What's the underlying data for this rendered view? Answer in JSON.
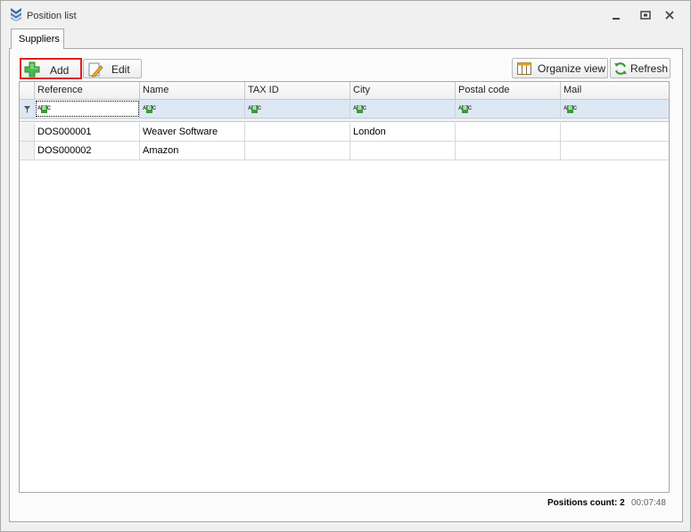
{
  "window": {
    "title": "Position list"
  },
  "tabs": [
    {
      "label": "Suppliers",
      "active": true
    }
  ],
  "toolbar": {
    "add_label": "Add",
    "edit_label": "Edit",
    "organize_label": "Organize view",
    "refresh_label": "Refresh"
  },
  "grid": {
    "columns": [
      "Reference",
      "Name",
      "TAX ID",
      "City",
      "Postal code",
      "Mail"
    ],
    "filter_placeholder": "ABC",
    "rows": [
      [
        "DOS000001",
        "Weaver Software",
        "",
        "London",
        "",
        ""
      ],
      [
        "DOS000002",
        "Amazon",
        "",
        "",
        "",
        ""
      ]
    ]
  },
  "status": {
    "count_label": "Positions count: 2",
    "time": "00:07:48"
  },
  "colors": {
    "add_highlight": "#e02020",
    "filter_row": "#dde8f4",
    "accent_green": "#3c9a3c"
  }
}
